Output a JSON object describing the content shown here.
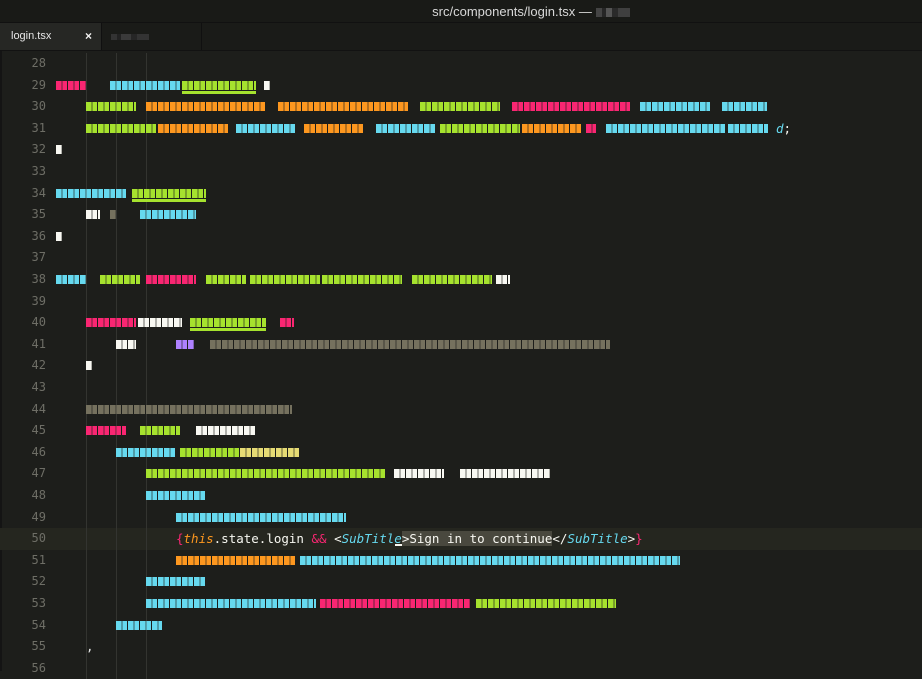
{
  "window": {
    "title": "src/components/login.tsx —"
  },
  "tabs": [
    {
      "label": "login.tsx",
      "close_glyph": "×",
      "active": true
    },
    {
      "label": "",
      "active": false
    }
  ],
  "editor": {
    "line_numbers": [
      "28",
      "29",
      "30",
      "31",
      "32",
      "33",
      "34",
      "35",
      "36",
      "37",
      "38",
      "39",
      "40",
      "41",
      "42",
      "43",
      "44",
      "45",
      "46",
      "47",
      "48",
      "49",
      "50",
      "51",
      "52",
      "53",
      "54",
      "55",
      "56"
    ],
    "current_line": "50",
    "line31_tail": "d;",
    "line55_text": ",",
    "line50": {
      "open_brace": "{",
      "this_kw": "this",
      "member": ".state.login ",
      "and_op": "&&",
      "space": " ",
      "tag_open_lt": "<",
      "tag_name_open": "SubTitle",
      "tag_open_gt": ">",
      "text": "Sign in to continue",
      "tag_close_lt": "</",
      "tag_name_close": "SubTitle",
      "tag_close_gt": ">",
      "close_brace": "}"
    }
  },
  "colors": {
    "background": "#1d1e1b",
    "keyword": "#f92672",
    "this": "#fd971f",
    "tag": "#66d9ef",
    "string_green": "#a6e22e",
    "purple": "#ae81ff"
  }
}
